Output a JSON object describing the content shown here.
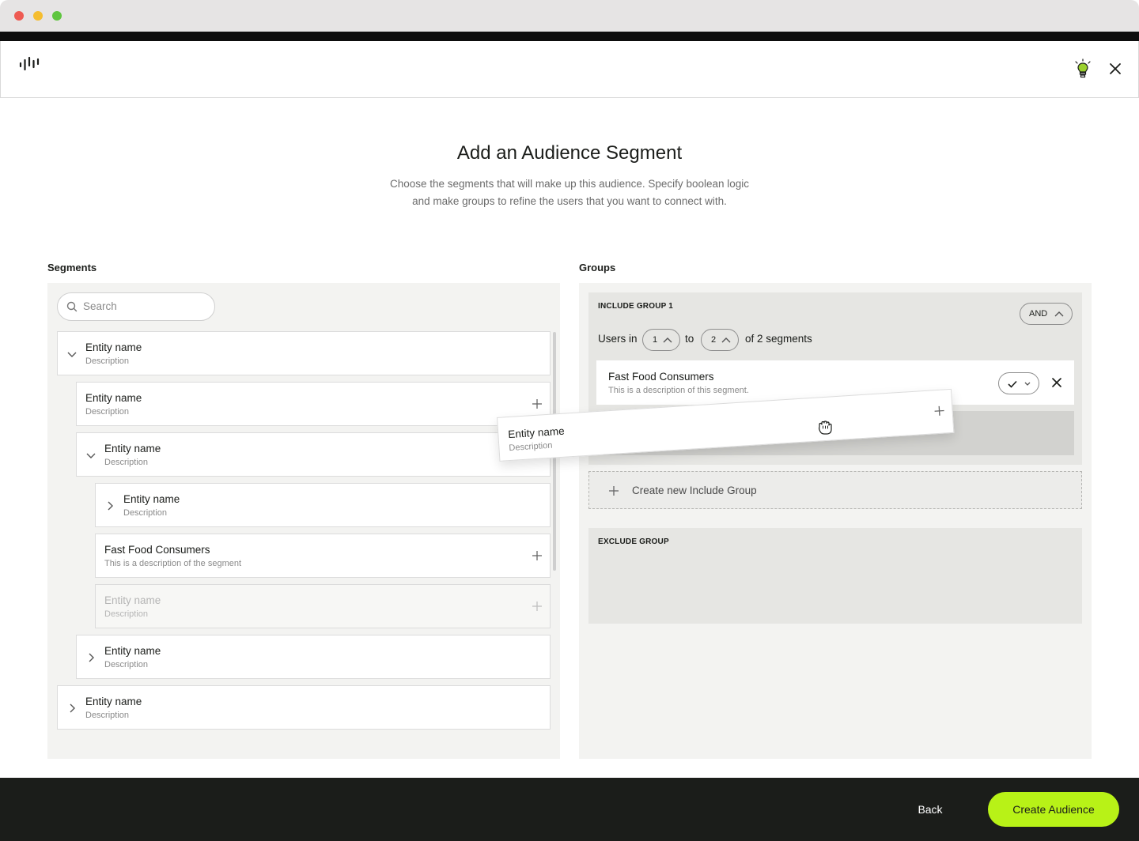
{
  "page": {
    "title": "Add an Audience Segment",
    "subtitle_line1": "Choose the segments that will make up this audience. Specify boolean logic",
    "subtitle_line2": "and make groups to refine the users that you want to connect with."
  },
  "header": {
    "logo_icon": "waveform-logo-icon",
    "hint_icon": "lightbulb-icon",
    "close_icon": "close-icon"
  },
  "segments": {
    "label": "Segments",
    "search_placeholder": "Search",
    "items": [
      {
        "name": "Entity name",
        "description": "Description",
        "level": 0,
        "state": "expanded"
      },
      {
        "name": "Entity name",
        "description": "Description",
        "level": 1,
        "state": "leaf"
      },
      {
        "name": "Entity name",
        "description": "Description",
        "level": 1,
        "state": "expanded"
      },
      {
        "name": "Entity name",
        "description": "Description",
        "level": 2,
        "state": "collapsed"
      },
      {
        "name": "Fast Food Consumers",
        "description": "This is a description of the segment",
        "level": 2,
        "state": "leaf"
      },
      {
        "name": "Entity name",
        "description": "Description",
        "level": 2,
        "state": "dragging-placeholder"
      },
      {
        "name": "Entity name",
        "description": "Description",
        "level": 1,
        "state": "collapsed"
      },
      {
        "name": "Entity name",
        "description": "Description",
        "level": 0,
        "state": "collapsed"
      }
    ]
  },
  "groups": {
    "label": "Groups",
    "include_group": {
      "title": "INCLUDE GROUP 1",
      "logic": "AND",
      "users_in": "Users in",
      "min": "1",
      "to": "to",
      "max": "2",
      "of_segments": "of 2 segments",
      "segment": {
        "name": "Fast Food Consumers",
        "description": "This is a description of this segment."
      }
    },
    "create_include_label": "Create new Include Group",
    "exclude_group": {
      "title": "EXCLUDE GROUP"
    }
  },
  "drag_item": {
    "name": "Entity name",
    "description": "Description"
  },
  "footer": {
    "back_label": "Back",
    "create_label": "Create Audience"
  },
  "colors": {
    "accent": "#b8f217",
    "footer_bg": "#1b1d1a",
    "panel_bg": "#f3f3f1",
    "group_bg": "#e6e6e3"
  }
}
